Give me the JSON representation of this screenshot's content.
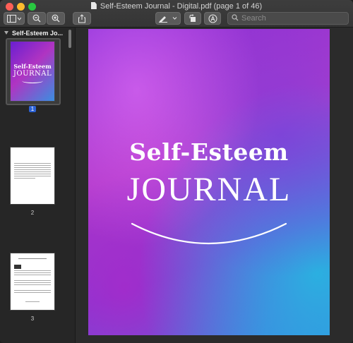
{
  "window": {
    "title": "Self-Esteem Journal - Digital.pdf (page 1 of 46)"
  },
  "toolbar": {
    "buttons": [
      {
        "name": "sidebar-toggle",
        "icon": "sidebar-icon"
      },
      {
        "name": "zoom-out",
        "icon": "zoom-out-icon"
      },
      {
        "name": "zoom-in",
        "icon": "zoom-in-icon"
      },
      {
        "name": "share",
        "icon": "share-icon"
      },
      {
        "name": "markup-pen",
        "icon": "pen-icon"
      },
      {
        "name": "rotate",
        "icon": "rotate-icon"
      },
      {
        "name": "annotate",
        "icon": "markup-circle-icon"
      }
    ],
    "search_placeholder": "Search"
  },
  "sidebar": {
    "header": "Self-Esteem Jo...",
    "thumbnails": [
      {
        "page": "1",
        "selected": true,
        "cover_line1": "Self-Esteem",
        "cover_line2": "JOURNAL"
      },
      {
        "page": "2",
        "selected": false
      },
      {
        "page": "3",
        "selected": false
      }
    ]
  },
  "document": {
    "cover_line1": "Self-Esteem",
    "cover_line2": "JOURNAL"
  },
  "colors": {
    "accent": "#2d62d5",
    "cover_purple": "#b23cc9",
    "cover_blue": "#3d7ee0"
  }
}
